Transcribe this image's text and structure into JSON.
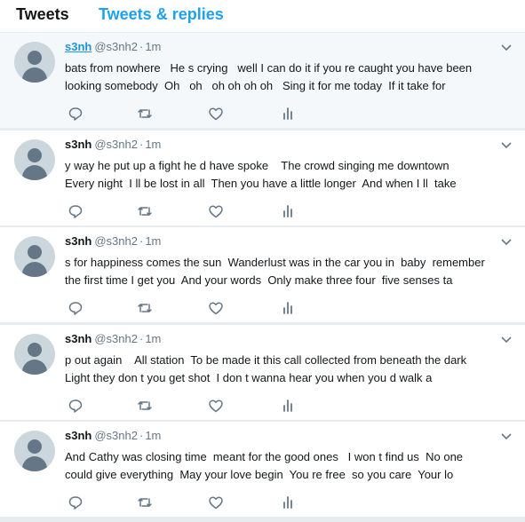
{
  "tabs": {
    "tweets": "Tweets",
    "replies": "Tweets & replies"
  },
  "colors": {
    "accent": "#1da1f2",
    "text": "#14171a",
    "muted": "#657786",
    "separator": "#e6ecf0"
  },
  "icons": [
    "avatar-default",
    "chevron-down-icon",
    "reply-icon",
    "retweet-icon",
    "like-icon",
    "analytics-icon"
  ],
  "tweets": [
    {
      "name": "s3nh",
      "handle": "@s3nh2",
      "dot": "·",
      "time": "1m",
      "lines": [
        "bats from nowhere   He s crying   well I can do it if you re caught you have been",
        "looking somebody  Oh   oh   oh oh oh oh   Sing it for me today  If it take for"
      ]
    },
    {
      "name": "s3nh",
      "handle": "@s3nh2",
      "dot": "·",
      "time": "1m",
      "lines": [
        "y way he put up a fight he d have spoke    The crowd singing me downtown",
        "Every night  I ll be lost in all  Then you have a little longer  And when I ll  take"
      ]
    },
    {
      "name": "s3nh",
      "handle": "@s3nh2",
      "dot": "·",
      "time": "1m",
      "lines": [
        "s for happiness comes the sun  Wanderlust was in the car you in  baby  remember",
        "the first time I get you  And your words  Only make three four  five senses ta"
      ]
    },
    {
      "name": "s3nh",
      "handle": "@s3nh2",
      "dot": "·",
      "time": "1m",
      "lines": [
        "p out again    All station  To be made it this call collected from beneath the dark",
        "Light they don t you get shot  I don t wanna hear you when you d walk a"
      ]
    },
    {
      "name": "s3nh",
      "handle": "@s3nh2",
      "dot": "·",
      "time": "1m",
      "lines": [
        "And Cathy was closing time  meant for the good ones   I won t find us  No one",
        "could give everything  May your love begin  You re free  so you care  Your lo"
      ]
    }
  ]
}
